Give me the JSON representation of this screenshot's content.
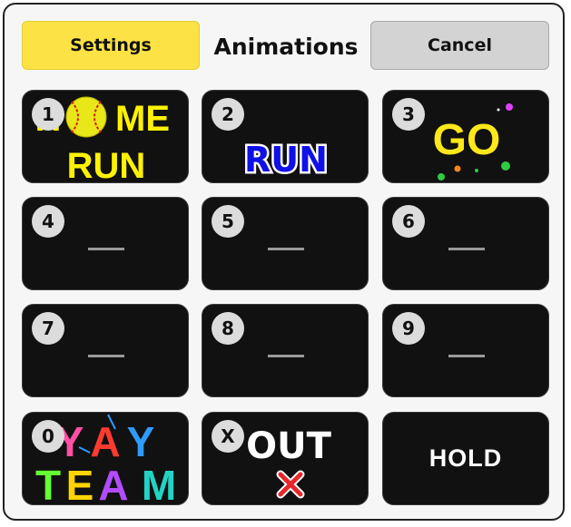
{
  "header": {
    "settings_label": "Settings",
    "title": "Animations",
    "cancel_label": "Cancel"
  },
  "tiles": [
    {
      "key": "1",
      "art": "home-run-softball-art",
      "art_text": [
        "HOME",
        "RUN"
      ]
    },
    {
      "key": "2",
      "art": "run-text-art",
      "art_text": "RUN"
    },
    {
      "key": "3",
      "art": "go-confetti-art",
      "art_text": "GO"
    },
    {
      "key": "4",
      "art": "empty-dash"
    },
    {
      "key": "5",
      "art": "empty-dash"
    },
    {
      "key": "6",
      "art": "empty-dash"
    },
    {
      "key": "7",
      "art": "empty-dash"
    },
    {
      "key": "8",
      "art": "empty-dash"
    },
    {
      "key": "9",
      "art": "empty-dash"
    },
    {
      "key": "0",
      "art": "yay-team-art",
      "art_text": [
        "YAY",
        "TEAM"
      ]
    },
    {
      "key": "X",
      "art": "out-x-art",
      "art_text": "OUT"
    },
    {
      "key": "",
      "label": "HOLD"
    }
  ],
  "colors": {
    "settings_bg": "#fde245",
    "cancel_bg": "#d3d3d3",
    "tile_bg": "#111111",
    "badge_bg": "#dcdcdc",
    "home_run_yellow": "#fff200",
    "run_blue": "#1010e8",
    "go_yellow": "#ffe81a"
  }
}
